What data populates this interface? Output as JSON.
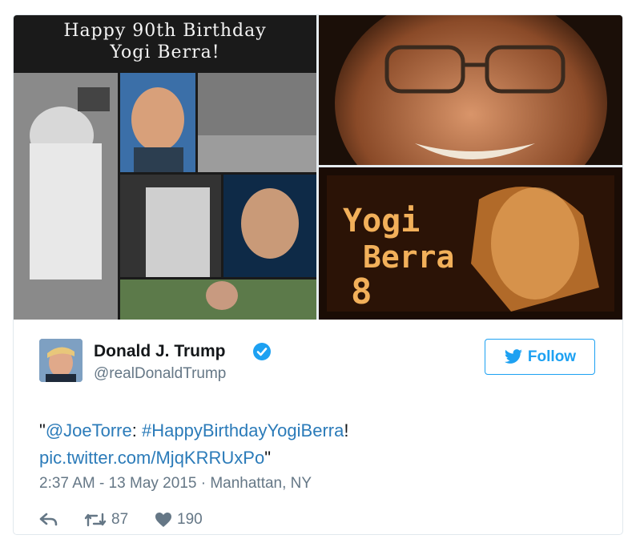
{
  "media": {
    "collage_title_line1": "Happy 90th Birthday",
    "collage_title_line2": "Yogi Berra!",
    "scoreboard_line1": "Yogi",
    "scoreboard_line2": "Berra",
    "scoreboard_number": "8"
  },
  "tweet": {
    "display_name": "Donald J. Trump",
    "handle": "@realDonaldTrump",
    "follow_label": "Follow",
    "text_open_quote": "\"",
    "mention": "@JoeTorre",
    "colon": ": ",
    "hashtag": "#HappyBirthdayYogiBerra",
    "exclaim": "!",
    "link": "pic.twitter.com/MjqKRRUxPo",
    "text_close_quote": "\"",
    "timestamp": "2:37 AM - 13 May 2015 · Manhattan, NY",
    "retweet_count": "87",
    "like_count": "190"
  },
  "colors": {
    "link": "#2b7bb9",
    "brand": "#1da1f2",
    "muted": "#657786"
  },
  "icons": [
    "reply-icon",
    "retweet-icon",
    "like-icon",
    "verified-icon",
    "twitter-bird-icon"
  ]
}
